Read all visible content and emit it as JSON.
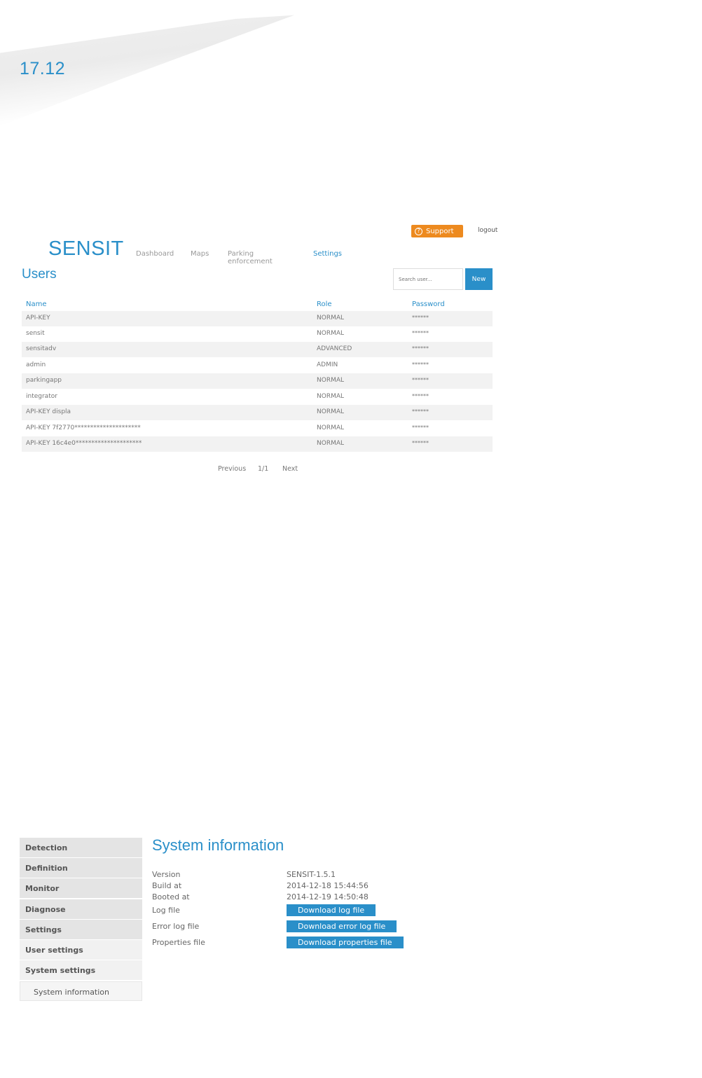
{
  "page_number": "17.12",
  "users_screen": {
    "support_label": "Support",
    "logout_label": "logout",
    "logo": "SENSIT",
    "nav": [
      "Dashboard",
      "Maps",
      "Parking enforcement",
      "Settings"
    ],
    "active_nav": "Settings",
    "title": "Users",
    "search_placeholder": "Search user...",
    "new_label": "New",
    "columns": [
      "Name",
      "Role",
      "Password"
    ],
    "rows": [
      {
        "name": "API-KEY",
        "role": "NORMAL",
        "password": "******"
      },
      {
        "name": "sensit",
        "role": "NORMAL",
        "password": "******"
      },
      {
        "name": "sensitadv",
        "role": "ADVANCED",
        "password": "******"
      },
      {
        "name": "admin",
        "role": "ADMIN",
        "password": "******"
      },
      {
        "name": "parkingapp",
        "role": "NORMAL",
        "password": "******"
      },
      {
        "name": "integrator",
        "role": "NORMAL",
        "password": "******"
      },
      {
        "name": "API-KEY displa",
        "role": "NORMAL",
        "password": "******"
      },
      {
        "name": "API-KEY 7f2770*********************",
        "role": "NORMAL",
        "password": "******"
      },
      {
        "name": "API-KEY 16c4e0*********************",
        "role": "NORMAL",
        "password": "******"
      }
    ],
    "pager": {
      "previous": "Previous",
      "page": "1/1",
      "next": "Next"
    }
  },
  "system_screen": {
    "sidebar": [
      "Detection",
      "Definition",
      "Monitor",
      "Diagnose",
      "Settings",
      "User settings",
      "System settings",
      "System information"
    ],
    "title": "System information",
    "version_label": "Version",
    "version_value": "SENSIT-1.5.1",
    "build_label": "Build at",
    "build_value": "2014-12-18 15:44:56",
    "booted_label": "Booted at",
    "booted_value": "2014-12-19 14:50:48",
    "log_label": "Log file",
    "log_button": "Download log file",
    "error_log_label": "Error log file",
    "error_log_button": "Download error log file",
    "properties_label": "Properties file",
    "properties_button": "Download properties file"
  },
  "colors": {
    "accent": "#2a8fc9",
    "support": "#ed8a1f"
  }
}
